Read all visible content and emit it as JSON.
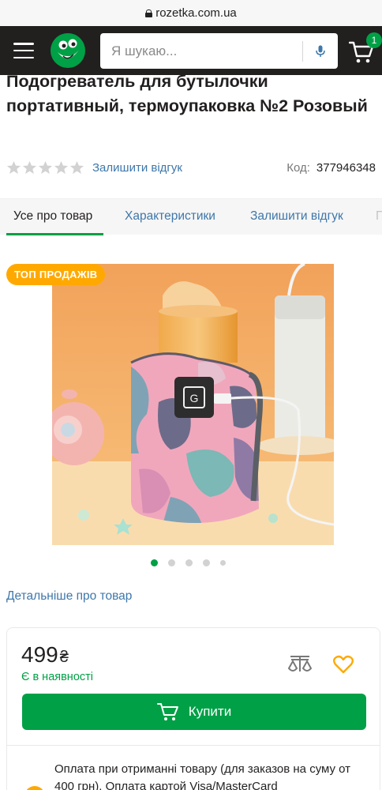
{
  "browser": {
    "url": "rozetka.com.ua"
  },
  "header": {
    "search_placeholder": "Я шукаю...",
    "cart_count": "1"
  },
  "product": {
    "title": "Подогреватель для бутылочки портативный, термоупаковка №2 Розовый",
    "rating_stars": 0,
    "review_link": "Залишити відгук",
    "code_label": "Код:",
    "code_value": "377946348"
  },
  "tabs": [
    {
      "label": "Усе про товар",
      "active": true
    },
    {
      "label": "Характеристики",
      "active": false
    },
    {
      "label": "Залишити відгук",
      "active": false
    },
    {
      "label": "П",
      "active": false
    }
  ],
  "gallery": {
    "badge": "ТОП ПРОДАЖІВ",
    "dot_count": 5,
    "active_dot": 0
  },
  "details_link": "Детальніше про товар",
  "buy_block": {
    "price": "499",
    "currency": "₴",
    "stock": "Є в наявності",
    "buy_label": "Купити",
    "payment_text": "Оплата при отриманні товару (для заказов на суму от 400 грн). Оплата картой Visa/MasterCard"
  },
  "colors": {
    "brand_green": "#00a046",
    "header_dark": "#221f1f",
    "link_blue": "#3e77aa",
    "badge_orange": "#ffa900"
  }
}
